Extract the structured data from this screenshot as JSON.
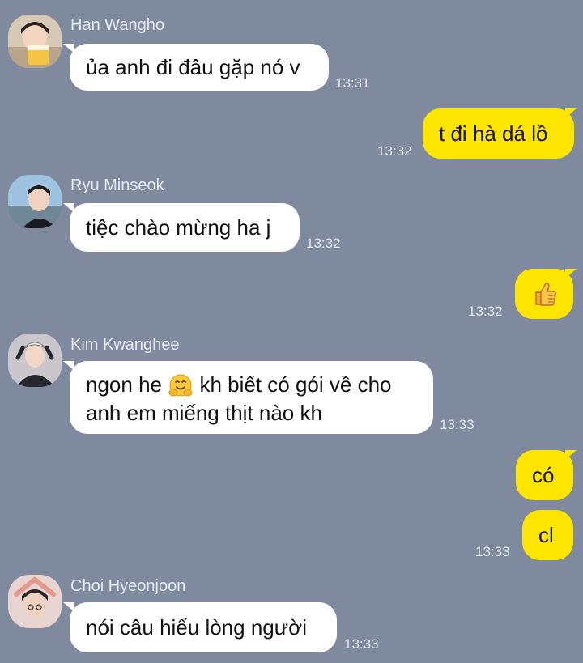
{
  "messages": [
    {
      "sender": "Han Wangho",
      "text": "ủa anh đi đâu gặp nó v",
      "time": "13:31"
    },
    {
      "sender": "me",
      "text": "t đi hà dá lồ",
      "time": "13:32"
    },
    {
      "sender": "Ryu Minseok",
      "text": "tiệc chào mừng ha j",
      "time": "13:32"
    },
    {
      "sender": "me",
      "text": "",
      "emoji": "thumbs-up-icon",
      "time": "13:32"
    },
    {
      "sender": "Kim Kwanghee",
      "text_line1_a": "ngon he",
      "emoji": "hugging-face-icon",
      "text_line1_b": "kh biết có gói về cho",
      "text_line2": "anh em miếng thịt nào kh",
      "time": "13:33"
    },
    {
      "sender": "me",
      "text": "có",
      "time": ""
    },
    {
      "sender": "me",
      "text": "cl",
      "time": "13:33"
    },
    {
      "sender": "Choi Hyeonjoon",
      "text": "nói câu hiểu lòng người",
      "time": "13:33"
    }
  ],
  "colors": {
    "background": "#7f8a9e",
    "incoming_bubble": "#ffffff",
    "outgoing_bubble": "#fee500"
  }
}
